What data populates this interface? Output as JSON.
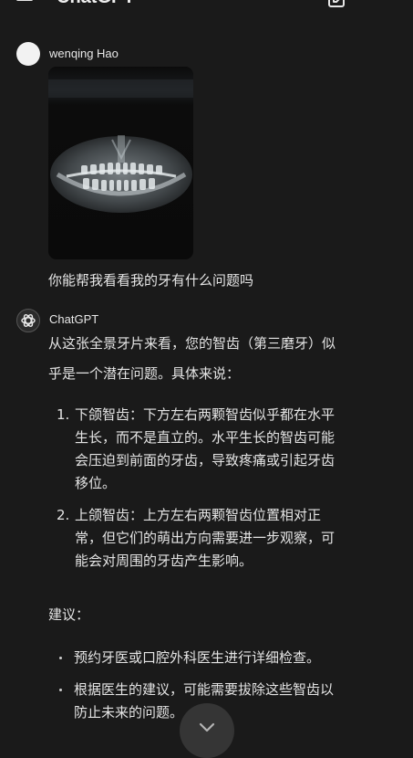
{
  "header": {
    "title": "ChatGPT"
  },
  "user": {
    "name": "wenqing Hao",
    "message": "你能帮我看看我的牙有什么问题吗"
  },
  "assistant": {
    "name": "ChatGPT",
    "intro_line1": "从这张全景牙片来看，您的智齿（第三磨牙）似",
    "intro_line2": "乎是一个潜在问题。具体来说：",
    "numbered": [
      {
        "num": "1.",
        "lines": [
          "下颌智齿：下方左右两颗智齿似乎都在水平",
          "生长，而不是直立的。水平生长的智齿可能",
          "会压迫到前面的牙齿，导致疼痛或引起牙齿",
          "移位。"
        ]
      },
      {
        "num": "2.",
        "lines": [
          "上颌智齿：上方左右两颗智齿位置相对正",
          "常，但它们的萌出方向需要进一步观察，可",
          "能会对周围的牙齿产生影响。"
        ]
      }
    ],
    "advice_label": "建议：",
    "bullets": [
      {
        "lines": [
          "预约牙医或口腔外科医生进行详细检查。"
        ]
      },
      {
        "lines": [
          "根据医生的建议，可能需要拔除这些智齿以",
          "防止未来的问题。"
        ]
      }
    ]
  },
  "icons": {
    "menu": "menu-icon",
    "compose": "compose-icon",
    "more": "more-icon",
    "gpt_logo": "openai-logo-icon",
    "scroll_down": "chevron-down-icon"
  }
}
